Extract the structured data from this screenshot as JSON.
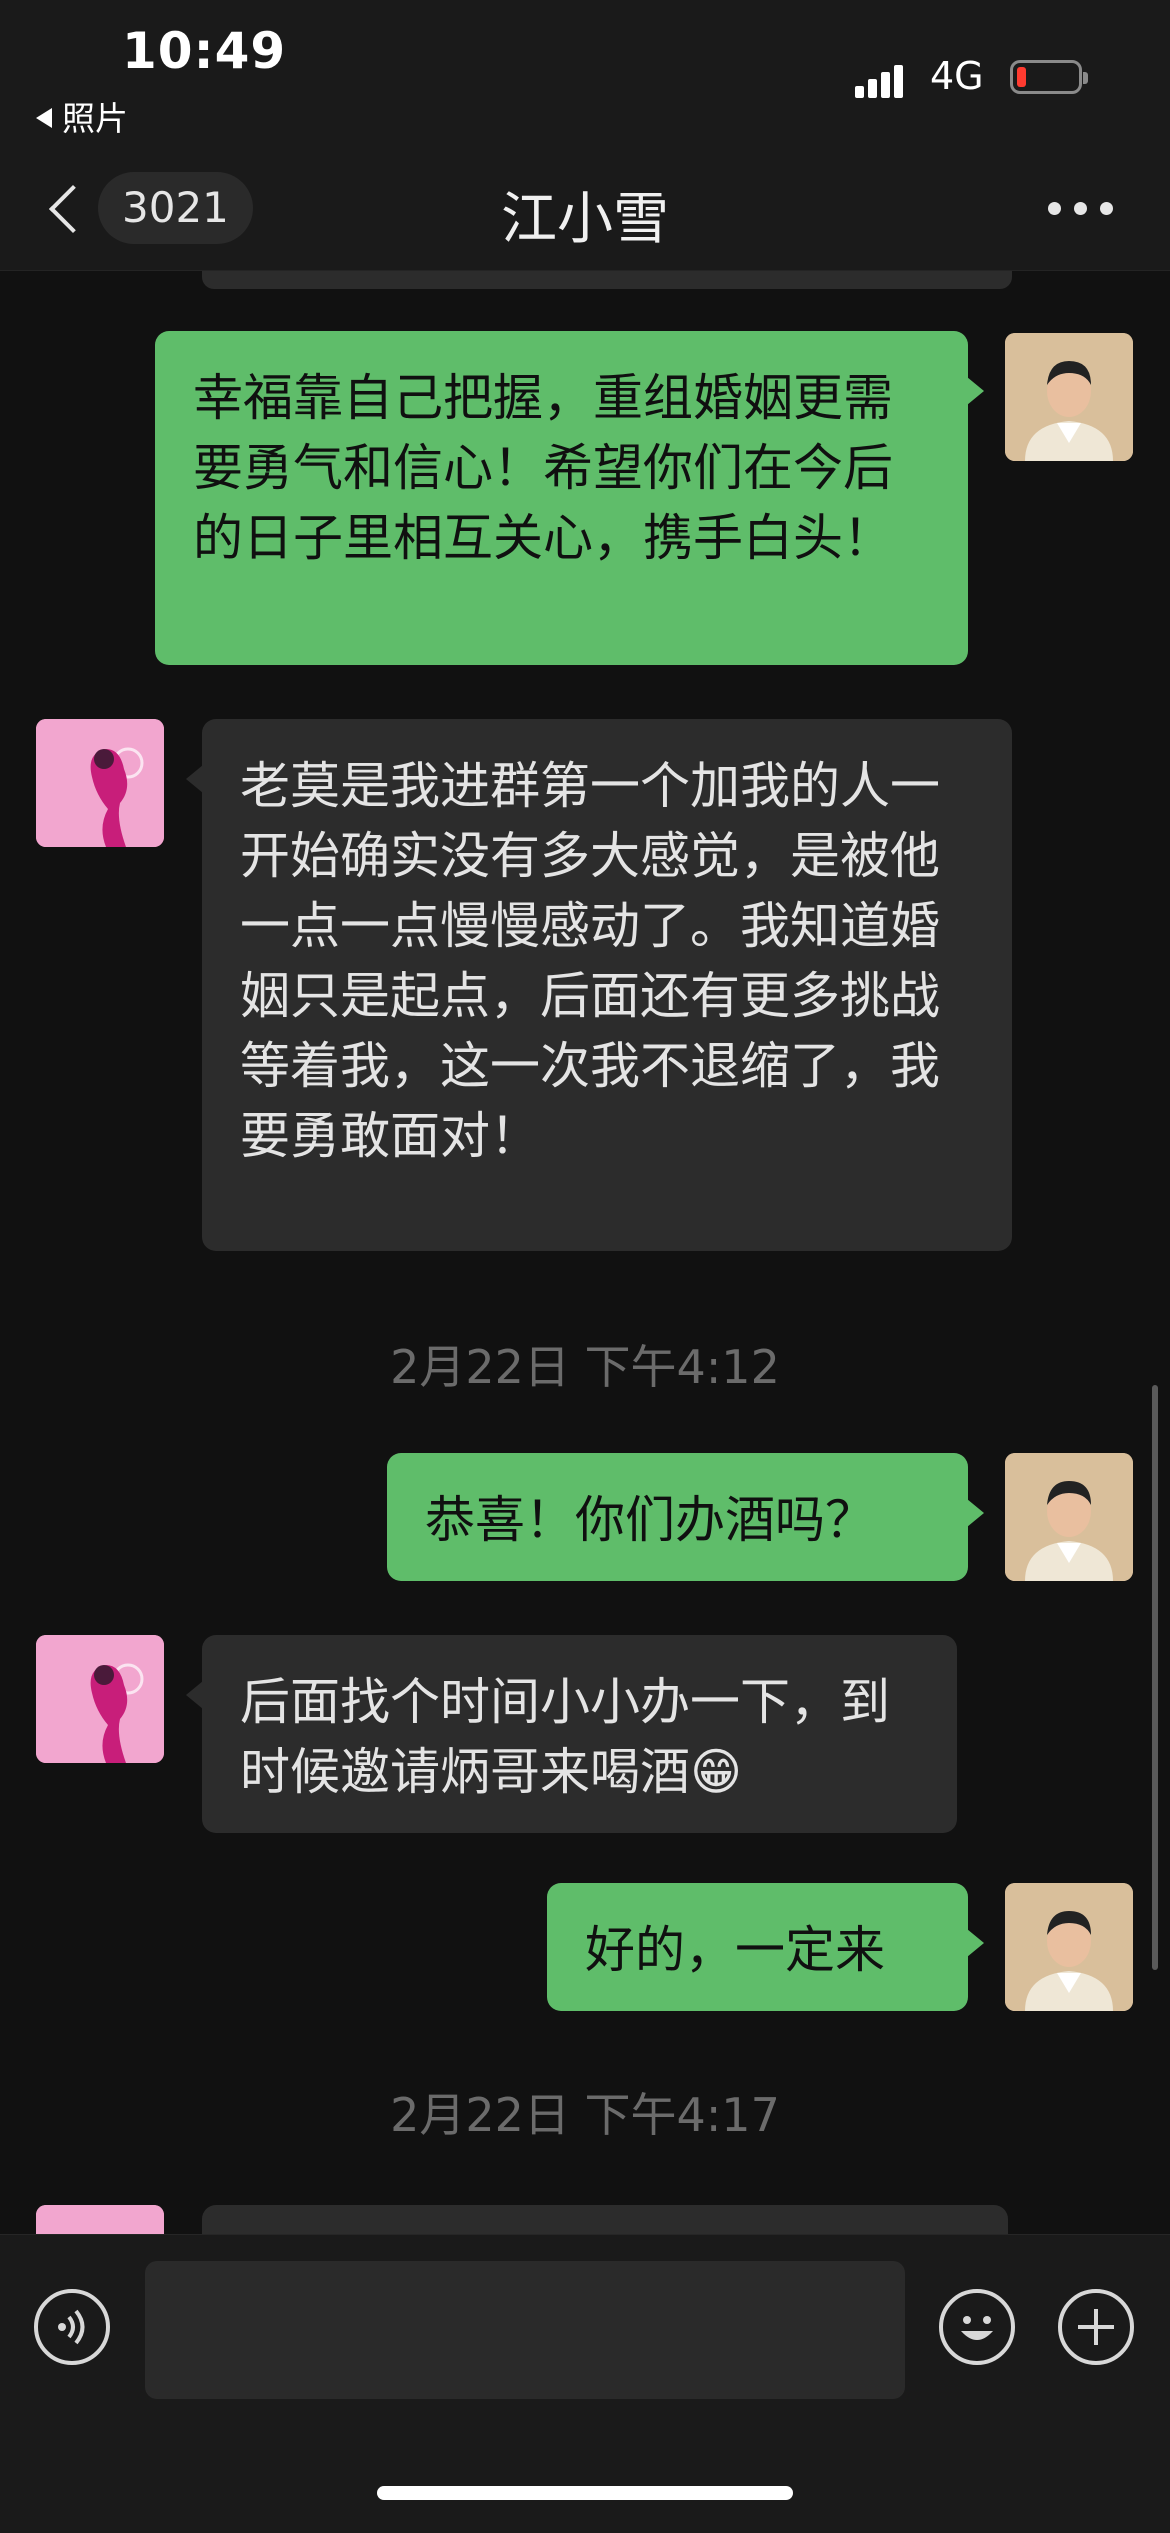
{
  "status_bar": {
    "time": "10:49",
    "back_to_app": "照片",
    "network": "4G",
    "battery_color": "#ff3b30"
  },
  "nav": {
    "unread_count": "3021",
    "title": "江小雪",
    "more_icon": "ellipsis-icon"
  },
  "colors": {
    "sent_bubble": "#5fbd6a",
    "received_bubble": "#2c2c2c",
    "background": "#111111"
  },
  "messages": [
    {
      "from": "me",
      "text": "幸福靠自己把握，重组婚姻更需要勇气和信心！希望你们在今后的日子里相互关心，携手白头！"
    },
    {
      "from": "contact",
      "text": "老莫是我进群第一个加我的人一开始确实没有多大感觉，是被他一点一点慢慢感动了。我知道婚姻只是起点，后面还有更多挑战等着我，这一次我不退缩了，我要勇敢面对！"
    },
    {
      "type": "timestamp",
      "text": "2月22日 下午4:12"
    },
    {
      "from": "me",
      "text": "恭喜！你们办酒吗？"
    },
    {
      "from": "contact",
      "text": "后面找个时间小小办一下，到时候邀请炳哥来喝酒😁"
    },
    {
      "from": "me",
      "text": "好的，一定来"
    },
    {
      "type": "timestamp",
      "text": "2月22日 下午4:17"
    }
  ],
  "input_bar": {
    "voice_icon": "voice-icon",
    "emoji_icon": "smiley-icon",
    "plus_icon": "plus-icon",
    "input_value": ""
  }
}
